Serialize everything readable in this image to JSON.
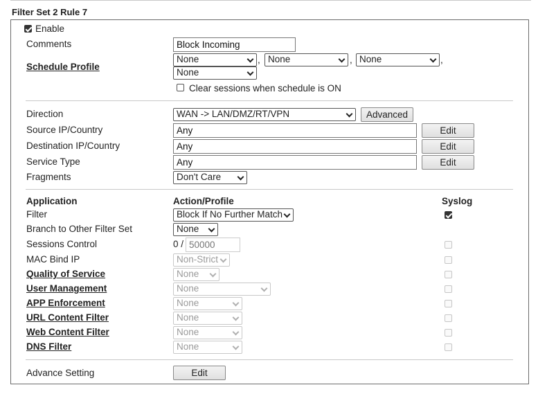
{
  "title": "Filter Set 2 Rule 7",
  "enable": {
    "label": "Enable",
    "checked": true
  },
  "comments": {
    "label": "Comments",
    "value": "Block Incoming"
  },
  "schedule": {
    "label": "Schedule Profile",
    "selects": [
      "None",
      "None",
      "None",
      "None"
    ],
    "separator": ",",
    "clear_sessions_label": "Clear sessions when schedule is ON",
    "clear_sessions_checked": false
  },
  "direction": {
    "label": "Direction",
    "value": "WAN -> LAN/DMZ/RT/VPN",
    "advanced_label": "Advanced"
  },
  "source": {
    "label": "Source IP/Country",
    "value": "Any",
    "edit_label": "Edit"
  },
  "destination": {
    "label": "Destination IP/Country",
    "value": "Any",
    "edit_label": "Edit"
  },
  "service": {
    "label": "Service Type",
    "value": "Any",
    "edit_label": "Edit"
  },
  "fragments": {
    "label": "Fragments",
    "value": "Don't Care"
  },
  "app_header": {
    "application": "Application",
    "action": "Action/Profile",
    "syslog": "Syslog"
  },
  "filter": {
    "label": "Filter",
    "value": "Block If No Further Match",
    "syslog_checked": true
  },
  "branch": {
    "label": "Branch to Other Filter Set",
    "value": "None"
  },
  "sessions": {
    "label": "Sessions Control",
    "current": "0 /",
    "max": "50000"
  },
  "mac_bind": {
    "label": "MAC Bind IP",
    "value": "Non-Strict"
  },
  "qos": {
    "label": "Quality of Service",
    "value": "None"
  },
  "user_mgmt": {
    "label": "User Management",
    "value": "None"
  },
  "app_enforce": {
    "label": "APP Enforcement",
    "value": "None"
  },
  "url_filter": {
    "label": "URL Content Filter",
    "value": "None"
  },
  "web_filter": {
    "label": "Web Content Filter",
    "value": "None"
  },
  "dns_filter": {
    "label": "DNS Filter",
    "value": "None"
  },
  "advance": {
    "label": "Advance Setting",
    "edit_label": "Edit"
  }
}
